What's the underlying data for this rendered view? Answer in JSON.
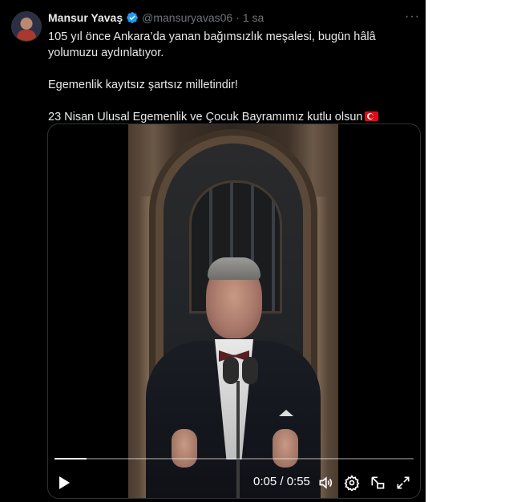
{
  "tweet": {
    "author_name": "Mansur Yavaş",
    "handle": "@mansuryavas06",
    "separator": "·",
    "time": "1 sa",
    "more_label": "···",
    "paragraphs": [
      "105 yıl önce Ankara’da yanan bağımsızlık meşalesi, bugün hâlâ yolumuzu aydınlatıyor.",
      "Egemenlik kayıtsız şartsız milletindir!",
      "23 Nisan Ulusal Egemenlik ve Çocuk Bayramımız kutlu olsun"
    ],
    "flag_icon": "turkey-flag-emoji"
  },
  "video": {
    "current_time": "0:05",
    "duration": "0:55",
    "time_display": "0:05 / 0:55",
    "progress": 0.09,
    "controls": [
      "play-icon",
      "volume-icon",
      "settings-icon",
      "picture-in-picture-icon",
      "fullscreen-icon"
    ]
  },
  "colors": {
    "background": "#000000",
    "text": "#e7e9ea",
    "secondary_text": "#71767b",
    "verified_badge": "#1d9bf0"
  }
}
